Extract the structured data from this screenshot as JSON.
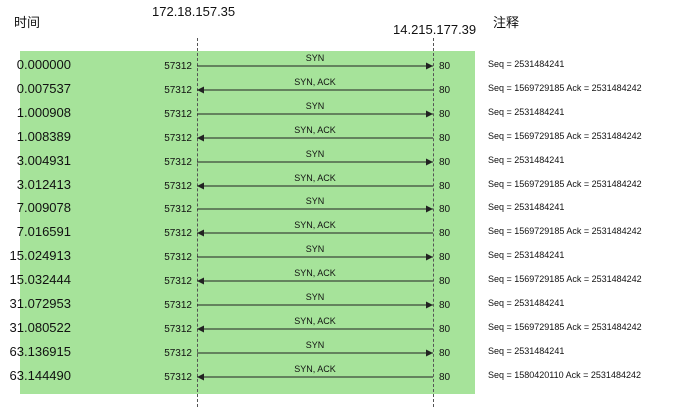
{
  "header": {
    "time_label": "时间",
    "left_host": "172.18.157.35",
    "right_host": "14.215.177.39",
    "notes_label": "注释"
  },
  "colors": {
    "flow_background": "#a6e39a",
    "line": "#222222"
  },
  "packets": [
    {
      "time": "0.000000",
      "src_port": "57312",
      "dst_port": "80",
      "flags": "SYN",
      "direction": "right",
      "note": "Seq = 2531484241"
    },
    {
      "time": "0.007537",
      "src_port": "57312",
      "dst_port": "80",
      "flags": "SYN, ACK",
      "direction": "left",
      "note": "Seq = 1569729185 Ack = 2531484242"
    },
    {
      "time": "1.000908",
      "src_port": "57312",
      "dst_port": "80",
      "flags": "SYN",
      "direction": "right",
      "note": "Seq = 2531484241"
    },
    {
      "time": "1.008389",
      "src_port": "57312",
      "dst_port": "80",
      "flags": "SYN, ACK",
      "direction": "left",
      "note": "Seq = 1569729185 Ack = 2531484242"
    },
    {
      "time": "3.004931",
      "src_port": "57312",
      "dst_port": "80",
      "flags": "SYN",
      "direction": "right",
      "note": "Seq = 2531484241"
    },
    {
      "time": "3.012413",
      "src_port": "57312",
      "dst_port": "80",
      "flags": "SYN, ACK",
      "direction": "left",
      "note": "Seq = 1569729185 Ack = 2531484242"
    },
    {
      "time": "7.009078",
      "src_port": "57312",
      "dst_port": "80",
      "flags": "SYN",
      "direction": "right",
      "note": "Seq = 2531484241"
    },
    {
      "time": "7.016591",
      "src_port": "57312",
      "dst_port": "80",
      "flags": "SYN, ACK",
      "direction": "left",
      "note": "Seq = 1569729185 Ack = 2531484242"
    },
    {
      "time": "15.024913",
      "src_port": "57312",
      "dst_port": "80",
      "flags": "SYN",
      "direction": "right",
      "note": "Seq = 2531484241"
    },
    {
      "time": "15.032444",
      "src_port": "57312",
      "dst_port": "80",
      "flags": "SYN, ACK",
      "direction": "left",
      "note": "Seq = 1569729185 Ack = 2531484242"
    },
    {
      "time": "31.072953",
      "src_port": "57312",
      "dst_port": "80",
      "flags": "SYN",
      "direction": "right",
      "note": "Seq = 2531484241"
    },
    {
      "time": "31.080522",
      "src_port": "57312",
      "dst_port": "80",
      "flags": "SYN, ACK",
      "direction": "left",
      "note": "Seq = 1569729185 Ack = 2531484242"
    },
    {
      "time": "63.136915",
      "src_port": "57312",
      "dst_port": "80",
      "flags": "SYN",
      "direction": "right",
      "note": "Seq = 2531484241"
    },
    {
      "time": "63.144490",
      "src_port": "57312",
      "dst_port": "80",
      "flags": "SYN, ACK",
      "direction": "left",
      "note": "Seq = 1580420110 Ack = 2531484242"
    }
  ]
}
